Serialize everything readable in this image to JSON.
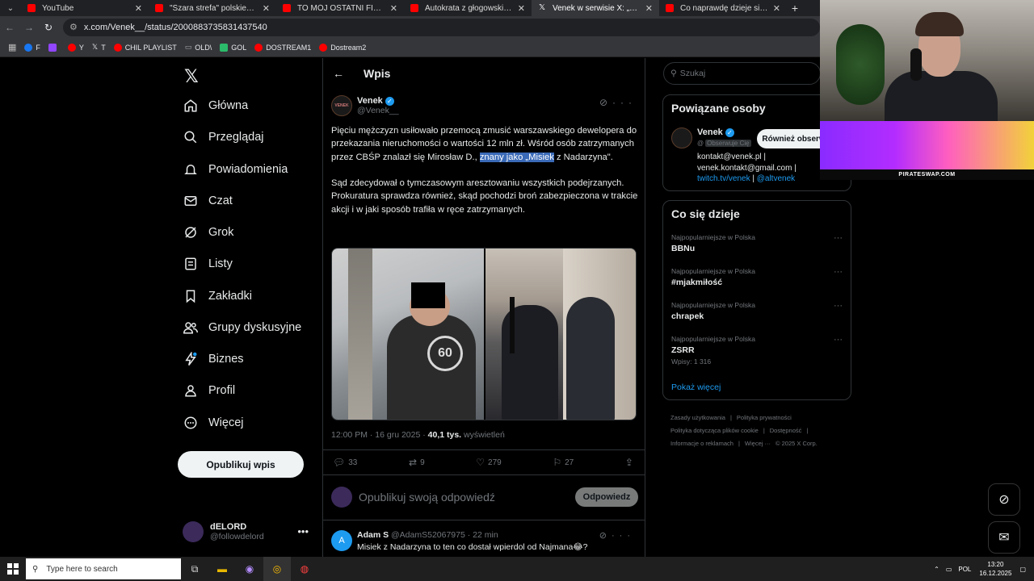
{
  "browser": {
    "tabs": [
      {
        "title": "YouTube",
        "icon": "youtube-icon",
        "active": false
      },
      {
        "title": "\"Szara strefa\" polskiego ubóstw",
        "icon": "youtube-icon",
        "active": false
      },
      {
        "title": "TO MÓJ OSTATNI FILM O FAZIE",
        "icon": "youtube-icon",
        "active": false
      },
      {
        "title": "Autokrata z głogowskiej huty w",
        "icon": "youtube-icon",
        "active": false
      },
      {
        "title": "Venek w serwisie X: „Pięciu mę",
        "icon": "x-icon",
        "active": true
      },
      {
        "title": "Co naprawdę dzieje się na uzbe",
        "icon": "youtube-icon",
        "active": false
      }
    ],
    "url": "x.com/Venek__/status/2000883735831437540",
    "bookmarks": [
      {
        "label": "F",
        "color": "#1877f2"
      },
      {
        "label": "",
        "color": "#9146ff"
      },
      {
        "label": "Y",
        "color": "#ff0000"
      },
      {
        "label": "T",
        "color": "#ffffff"
      },
      {
        "label": "CHIL PLAYLIST",
        "color": "#ff0000"
      },
      {
        "label": "OLD\\",
        "color": "#aaaaaa"
      },
      {
        "label": "GOL",
        "color": "#2bbb6b"
      },
      {
        "label": "DOSTREAM1",
        "color": "#ff0000"
      },
      {
        "label": "Dostream2",
        "color": "#ff0000"
      }
    ]
  },
  "nav": {
    "logo": "X",
    "items": [
      "Główna",
      "Przeglądaj",
      "Powiadomienia",
      "Czat",
      "Grok",
      "Listy",
      "Zakładki",
      "Grupy dyskusyjne",
      "Biznes",
      "Profil",
      "Więcej"
    ],
    "post_button": "Opublikuj wpis",
    "account": {
      "name": "dELORD",
      "handle": "@followdelord"
    }
  },
  "post": {
    "header": "Wpis",
    "author": {
      "name": "Venek",
      "handle": "@Venek__",
      "avatar_text": "VENEK"
    },
    "text_p1_before": "Pięciu mężczyzn usiłowało przemocą zmusić warszawskiego dewelopera do przekazania nieruchomości o wartości 12 mln zł. Wśród osób zatrzymanych przez CBŚP znalazł się Mirosław D., ",
    "text_p1_highlight": "znany jako „Misiek",
    "text_p1_after": " z Nadarzyna\".",
    "text_p2": "Sąd zdecydował o tymczasowym aresztowaniu wszystkich podejrzanych. Prokuratura sprawdza również, skąd pochodzi broń zabezpieczona w trakcie akcji i w jaki sposób trafiła w ręce zatrzymanych.",
    "tattoo_text": "60",
    "time": "12:00 PM · 16 gru 2025 · ",
    "views": "40,1 tys.",
    "views_label": " wyświetleń",
    "replies": "33",
    "reposts": "9",
    "likes": "279",
    "bookmarks": "27",
    "reply_placeholder": "Opublikuj swoją odpowiedź",
    "reply_button": "Odpowiedz"
  },
  "comment": {
    "avatar": "A",
    "name": "Adam S",
    "handle": " @AdamS52067975 · 22 min",
    "text": "Misiek z Nadarzyna to ten co dostał wpierdol od Najmana😂?"
  },
  "sidebar": {
    "search_placeholder": "Szukaj",
    "people_title": "Powiązane osoby",
    "person": {
      "name": "Venek",
      "follows_you": "Obserwuje Cię",
      "button": "Również obserwuj",
      "bio_line1": "kontakt@venek.pl |",
      "bio_line2": "venek.kontakt@gmail.com |",
      "bio_link1": "twitch.tv/venek",
      "bio_sep": " | ",
      "bio_link2": "@altvenek"
    },
    "trends_title": "Co się dzieje",
    "trends": [
      {
        "category": "Najpopularniejsze w Polska",
        "topic": "BBNu",
        "stats": ""
      },
      {
        "category": "Najpopularniejsze w Polska",
        "topic": "#mjakmiłość",
        "stats": ""
      },
      {
        "category": "Najpopularniejsze w Polska",
        "topic": "chrapek",
        "stats": ""
      },
      {
        "category": "Najpopularniejsze w Polska",
        "topic": "ZSRR",
        "stats": "Wpisy: 1 316"
      }
    ],
    "show_more": "Pokaż więcej",
    "footer": [
      "Zasady użytkowania",
      "|",
      "Polityka prywatności",
      "|",
      "Polityka dotycząca plików cookie",
      "|",
      "Dostępność",
      "|",
      "Informacje o reklamach",
      "|",
      "Więcej ···",
      "© 2025 X Corp."
    ]
  },
  "overlay": {
    "ad_label": "PIRATESWAP.COM"
  },
  "taskbar": {
    "search_placeholder": "Type here to search",
    "lang": "POL",
    "time": "13:20",
    "date": "16.12.2025"
  }
}
